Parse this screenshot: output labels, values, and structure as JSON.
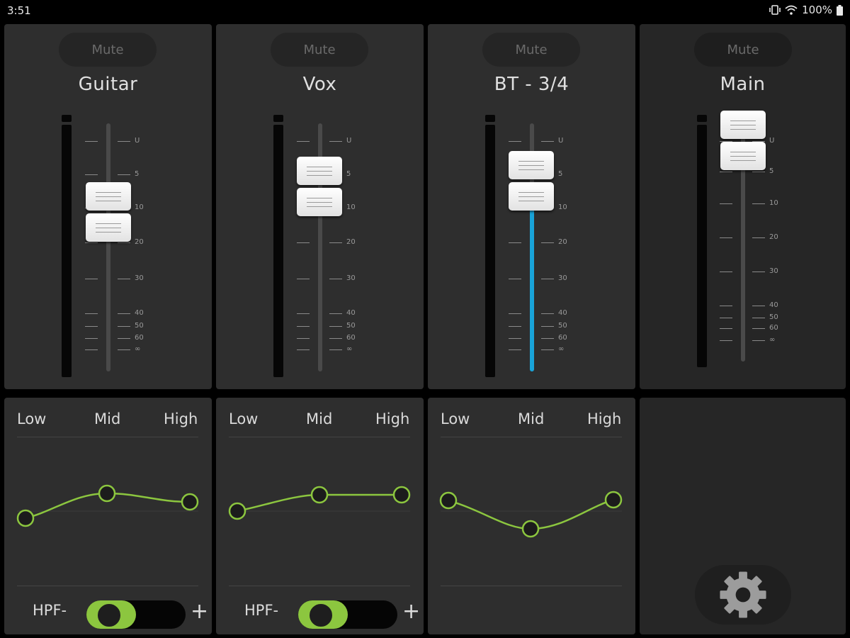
{
  "status_bar": {
    "time": "3:51",
    "battery": "100%"
  },
  "scale_labels": [
    "U",
    "5",
    "10",
    "20",
    "30",
    "40",
    "50",
    "60",
    "∞"
  ],
  "channels": [
    {
      "name": "Guitar",
      "mute_label": "Mute",
      "fader_level": "~8"
    },
    {
      "name": "Vox",
      "mute_label": "Mute",
      "fader_level": "~5"
    },
    {
      "name": "BT - 3/4",
      "mute_label": "Mute",
      "fader_level": "~5"
    },
    {
      "name": "Main",
      "mute_label": "Mute",
      "fader_level": "U"
    }
  ],
  "eq": [
    {
      "low": "Low",
      "mid": "Mid",
      "high": "High",
      "hpf_label": "HPF",
      "minus": "-",
      "plus": "+",
      "hpf_on": true
    },
    {
      "low": "Low",
      "mid": "Mid",
      "high": "High",
      "hpf_label": "HPF",
      "minus": "-",
      "plus": "+",
      "hpf_on": true
    },
    {
      "low": "Low",
      "mid": "Mid",
      "high": "High"
    }
  ],
  "colors": {
    "accent_green": "#8cc63f",
    "meter_blue": "#19a3d8",
    "panel": "#2e2e2e"
  },
  "icons": {
    "settings": "gear-icon"
  }
}
